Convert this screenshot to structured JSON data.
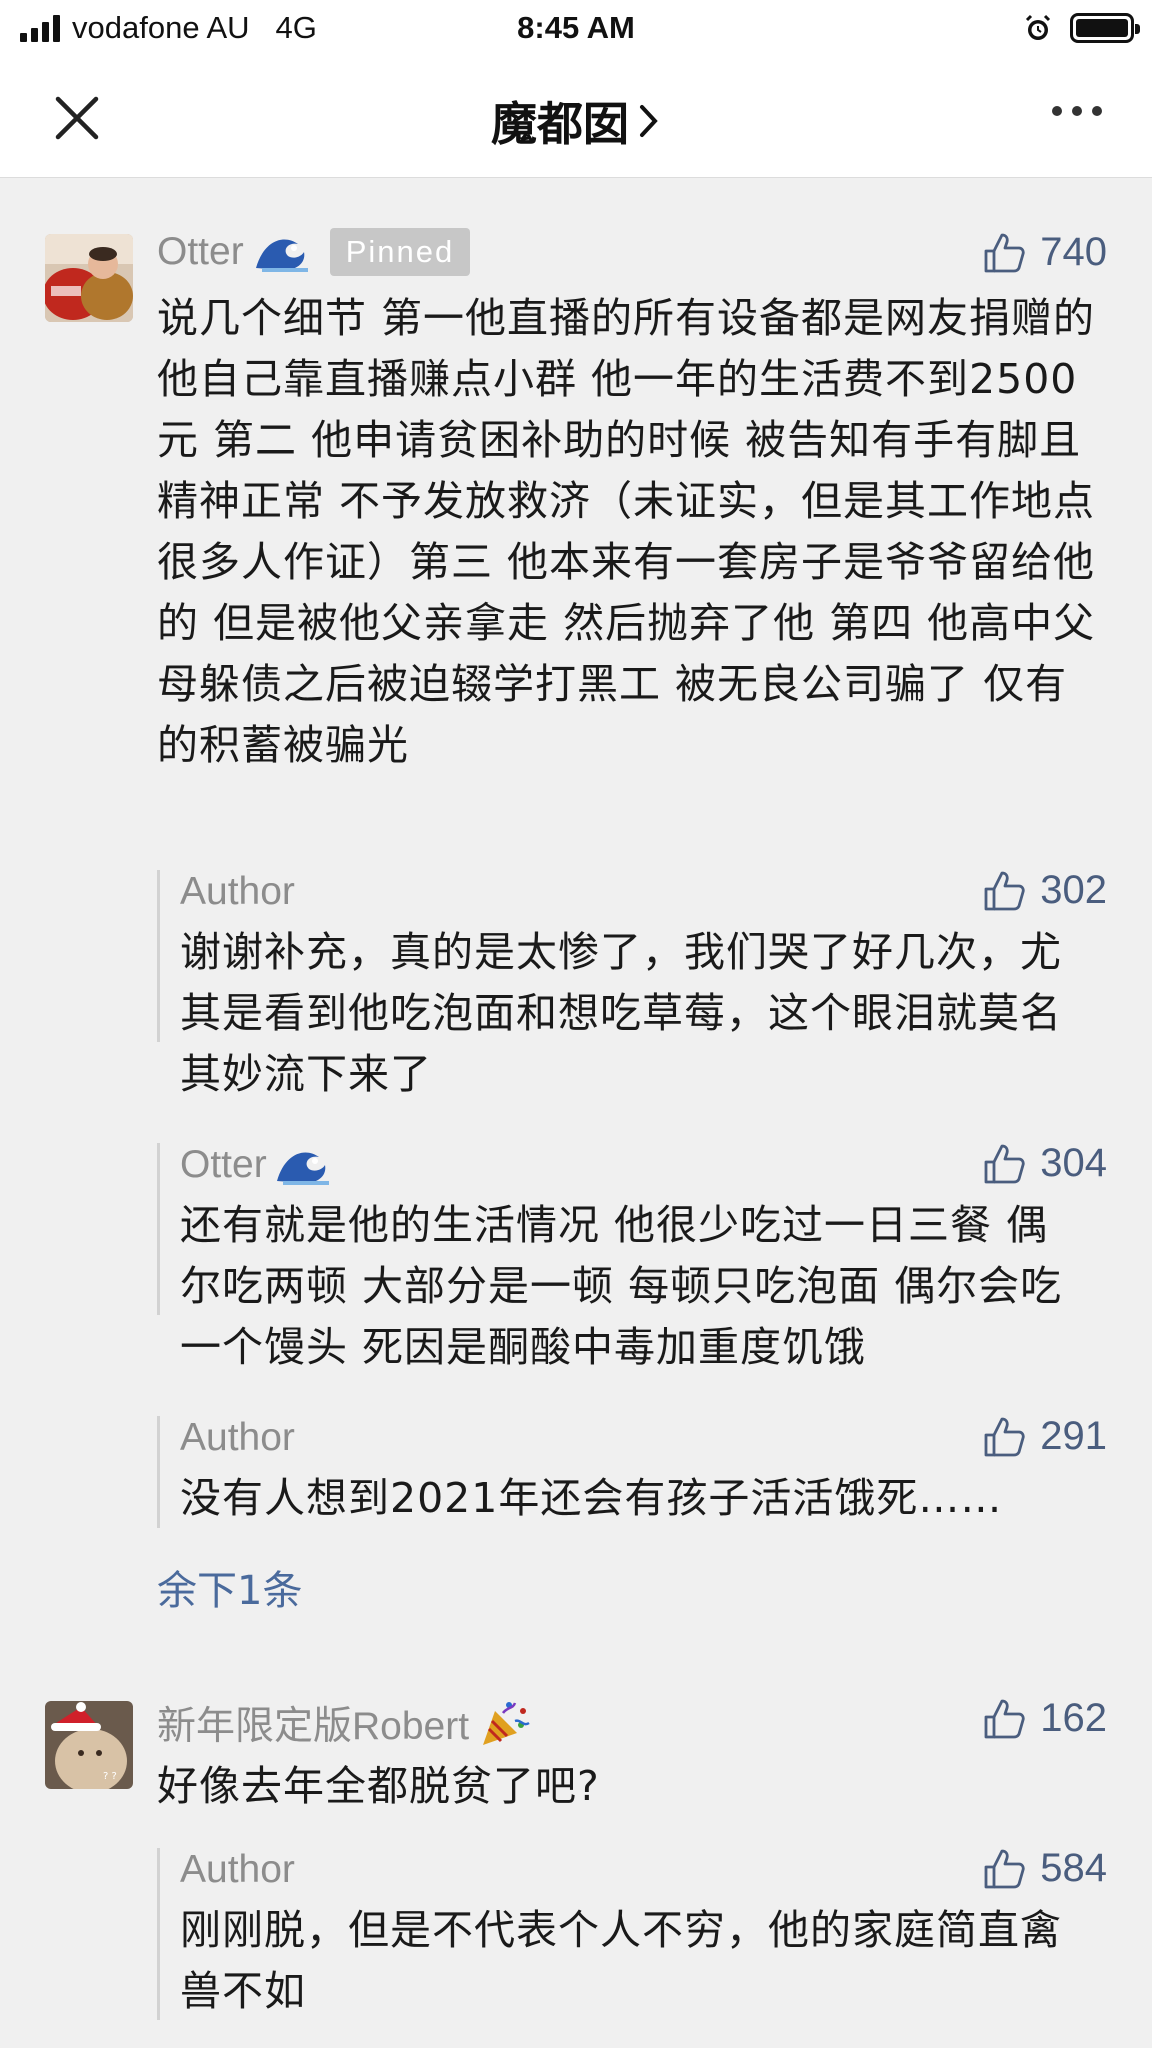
{
  "status_bar": {
    "carrier": "vodafone AU",
    "network": "4G",
    "time": "8:45 AM"
  },
  "nav": {
    "title": "魔都囡",
    "chevron": "›"
  },
  "comments": [
    {
      "name": "Otter",
      "name_emoji": "wave",
      "pinned_label": "Pinned",
      "likes": "740",
      "text": "说几个细节 第一他直播的所有设备都是网友捐赠的 他自己靠直播赚点小群 他一年的生活费不到2500元 第二 他申请贫困补助的时候 被告知有手有脚且精神正常 不予发放救济（未证实，但是其工作地点很多人作证）第三 他本来有一套房子是爷爷留给他的 但是被他父亲拿走 然后抛弃了他 第四 他高中父母躲债之后被迫辍学打黑工 被无良公司骗了 仅有的积蓄被骗光",
      "replies": [
        {
          "name": "Author",
          "likes": "302",
          "text": "谢谢补充，真的是太惨了，我们哭了好几次，尤其是看到他吃泡面和想吃草莓，这个眼泪就莫名其妙流下来了"
        },
        {
          "name": "Otter",
          "likes": "304",
          "text": "还有就是他的生活情况 他很少吃过一日三餐 偶尔吃两顿 大部分是一顿 每顿只吃泡面 偶尔会吃一个馒头 死因是酮酸中毒加重度饥饿"
        },
        {
          "name": "Author",
          "likes": "291",
          "text": "没有人想到2021年还会有孩子活活饿死……"
        }
      ],
      "more_replies": "余下1条"
    },
    {
      "name": "新年限定版Robert",
      "name_emoji": "party-popper",
      "likes": "162",
      "text": "好像去年全都脱贫了吧?",
      "replies": [
        {
          "name": "Author",
          "likes": "584",
          "text": "刚刚脱，但是不代表个人不穷，他的家庭简直禽兽不如"
        }
      ]
    }
  ],
  "colors": {
    "background": "#f0f0f0",
    "link": "#4a6a9c",
    "likes": "#4a5d7e",
    "name": "#8c8c8c",
    "pinned_bg": "#c7c7c7"
  }
}
